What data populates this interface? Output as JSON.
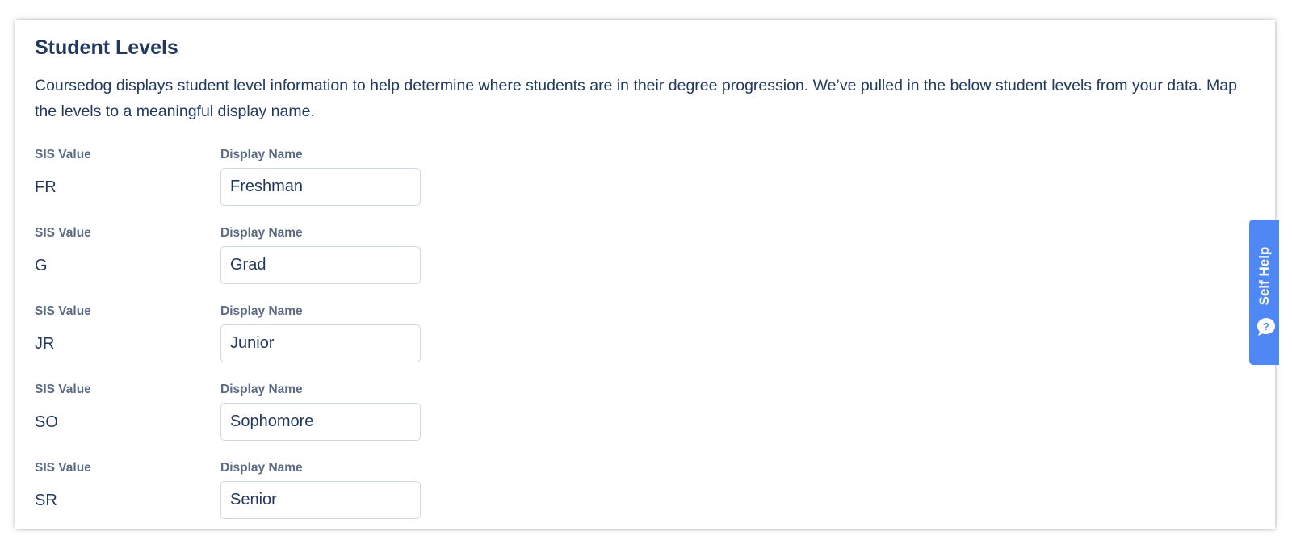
{
  "section": {
    "title": "Student Levels",
    "description": "Coursedog displays student level information to help determine where students are in their degree progression. We’ve pulled in the below student levels from your data. Map the levels to a meaningful display name."
  },
  "levels": [
    {
      "sis_label": "SIS Value",
      "sis_value": "FR",
      "display_label": "Display Name",
      "display_value": "Freshman"
    },
    {
      "sis_label": "SIS Value",
      "sis_value": "G",
      "display_label": "Display Name",
      "display_value": "Grad"
    },
    {
      "sis_label": "SIS Value",
      "sis_value": "JR",
      "display_label": "Display Name",
      "display_value": "Junior"
    },
    {
      "sis_label": "SIS Value",
      "sis_value": "SO",
      "display_label": "Display Name",
      "display_value": "Sophomore"
    },
    {
      "sis_label": "SIS Value",
      "sis_value": "SR",
      "display_label": "Display Name",
      "display_value": "Senior"
    }
  ],
  "self_help": {
    "label": "Self Help",
    "icon": "question-chat-icon",
    "color": "#4f87f4"
  },
  "colors": {
    "text": "#22395f",
    "label": "#5a6b85",
    "input_border": "#cfd8e3"
  }
}
